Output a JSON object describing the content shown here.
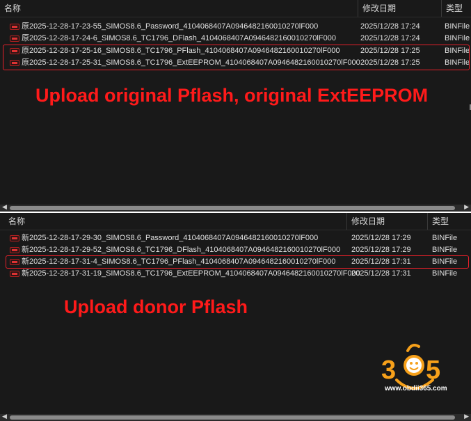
{
  "pane1": {
    "columns": [
      "名称",
      "修改日期",
      "类型"
    ],
    "rows": [
      {
        "name": "原2025-12-28-17-23-55_SIMOS8.6_Password_4104068407A0946482160010270lF000",
        "date": "2025/12/28 17:24",
        "type": "BINFile"
      },
      {
        "name": "原2025-12-28-17-24-6_SIMOS8.6_TC1796_DFlash_4104068407A0946482160010270lF000",
        "date": "2025/12/28 17:24",
        "type": "BINFile"
      },
      {
        "name": "原2025-12-28-17-25-16_SIMOS8.6_TC1796_PFlash_4104068407A0946482160010270lF000",
        "date": "2025/12/28 17:25",
        "type": "BINFile"
      },
      {
        "name": "原2025-12-28-17-25-31_SIMOS8.6_TC1796_ExtEEPROM_4104068407A0946482160010270lF000",
        "date": "2025/12/28 17:25",
        "type": "BINFile"
      }
    ],
    "annotation": "Upload original Pflash, original ExtEEPROM"
  },
  "pane2": {
    "columns": [
      "名称",
      "修改日期",
      "类型"
    ],
    "rows": [
      {
        "name": "新2025-12-28-17-29-30_SIMOS8.6_Password_4104068407A0946482160010270lF000",
        "date": "2025/12/28 17:29",
        "type": "BINFile"
      },
      {
        "name": "新2025-12-28-17-29-52_SIMOS8.6_TC1796_DFlash_4104068407A0946482160010270lF000",
        "date": "2025/12/28 17:29",
        "type": "BINFile"
      },
      {
        "name": "新2025-12-28-17-31-4_SIMOS8.6_TC1796_PFlash_4104068407A0946482160010270lF000",
        "date": "2025/12/28 17:31",
        "type": "BINFile"
      },
      {
        "name": "新2025-12-28-17-31-19_SIMOS8.6_TC1796_ExtEEPROM_4104068407A0946482160010270lF000",
        "date": "2025/12/28 17:31",
        "type": "BINFile"
      }
    ],
    "annotation": "Upload donor Pflash"
  },
  "watermark": {
    "digits": [
      "3",
      "6",
      "5"
    ],
    "url": "www.obdii365.com"
  },
  "colors": {
    "background": "#191919",
    "highlight": "#e8202a",
    "annotation": "#ff1a1a"
  }
}
